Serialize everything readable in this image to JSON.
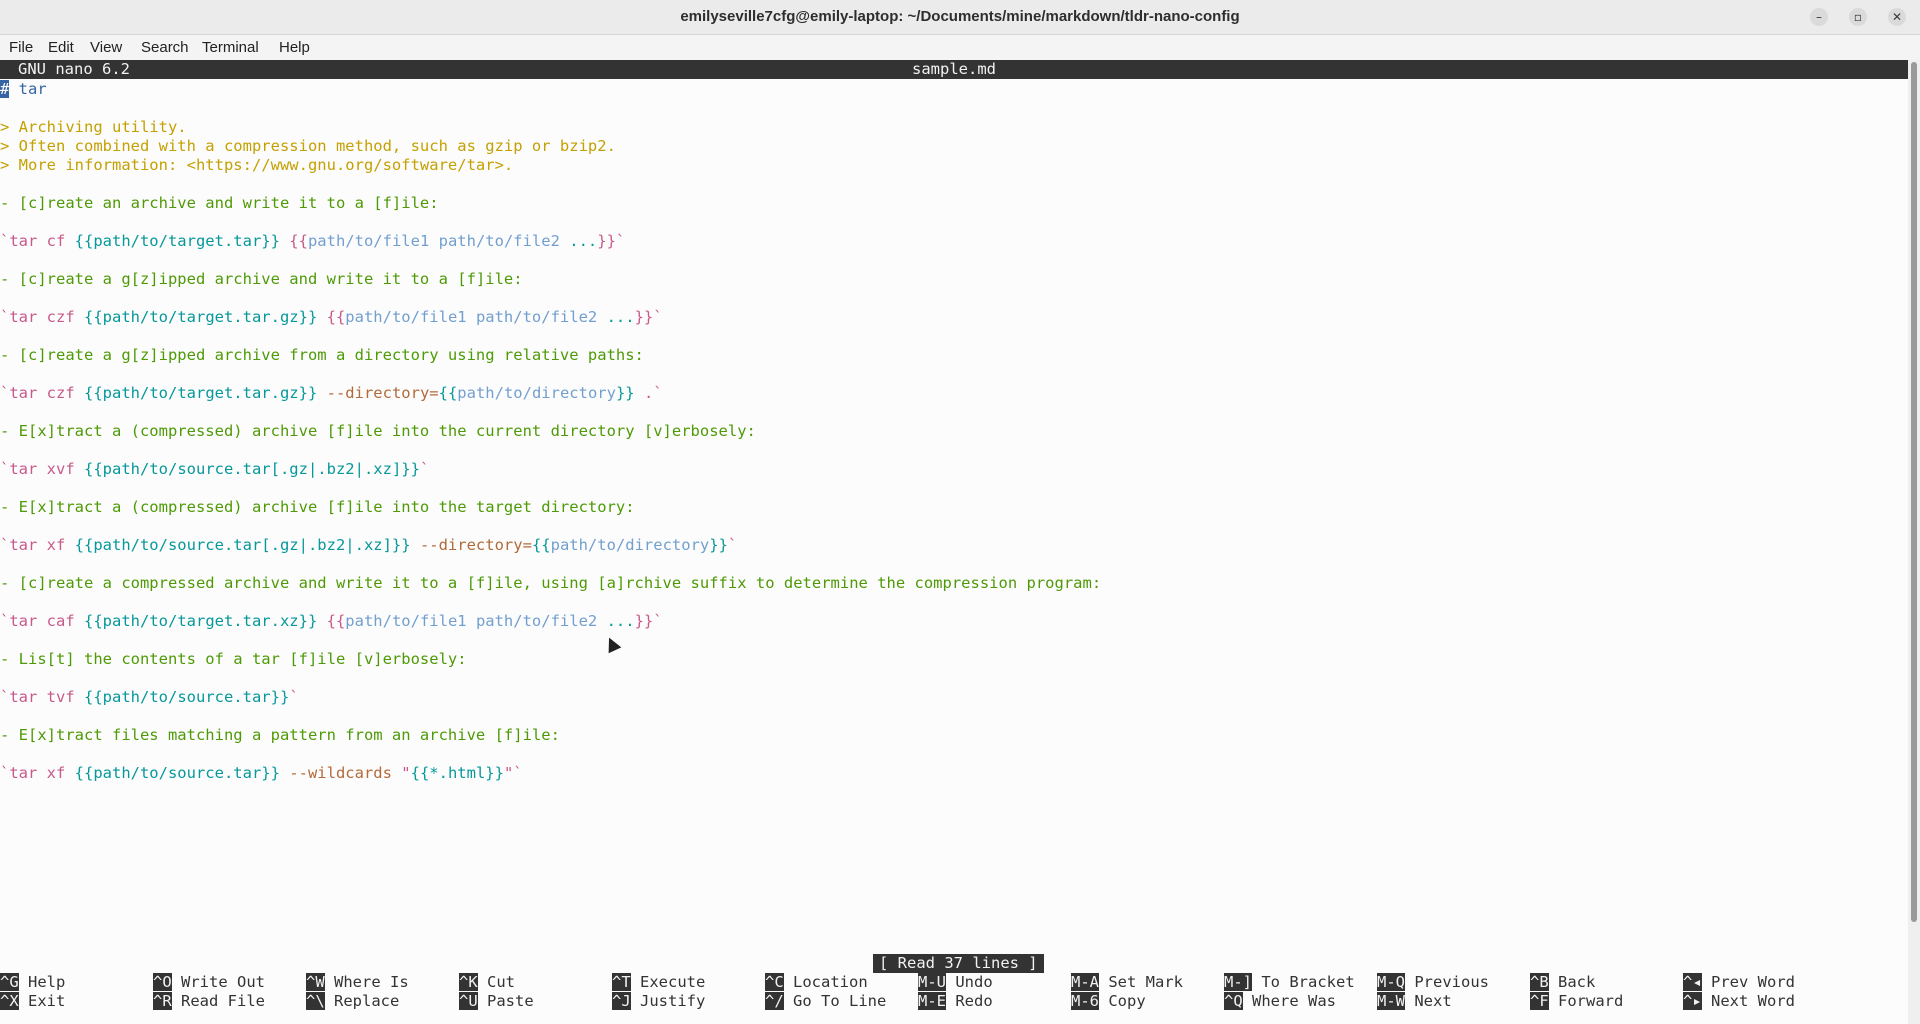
{
  "window": {
    "title": "emilyseville7cfg@emily-laptop: ~/Documents/mine/markdown/tldr-nano-config",
    "buttons": {
      "minimize": "–",
      "maximize": "▫",
      "close": "✕"
    }
  },
  "menu": [
    "File",
    "Edit",
    "View",
    "Search",
    "Terminal",
    "Help"
  ],
  "editor": {
    "version": "GNU nano 6.2",
    "filename": "sample.md",
    "status": "[ Read 37 lines ]"
  },
  "lines": [
    {
      "segs": [
        {
          "t": "#",
          "c": "cursor"
        },
        {
          "t": " tar",
          "c": "c-head"
        }
      ]
    },
    {
      "segs": []
    },
    {
      "segs": [
        {
          "t": "> Archiving utility.",
          "c": "c-quote"
        }
      ]
    },
    {
      "segs": [
        {
          "t": "> Often combined with a compression method, such as gzip or bzip2.",
          "c": "c-quote"
        }
      ]
    },
    {
      "segs": [
        {
          "t": "> More information: <https://www.gnu.org/software/tar>.",
          "c": "c-quote"
        }
      ]
    },
    {
      "segs": []
    },
    {
      "segs": [
        {
          "t": "- [c]reate an archive and write it to a [f]ile:",
          "c": "c-desc"
        }
      ]
    },
    {
      "segs": []
    },
    {
      "segs": [
        {
          "t": "`tar cf ",
          "c": "c-cmd"
        },
        {
          "t": "{{path/to/target.tar}}",
          "c": "c-tok"
        },
        {
          "t": " {{",
          "c": "c-cmd"
        },
        {
          "t": "path/to/file1 path/to/file2 ",
          "c": "c-var"
        },
        {
          "t": "...",
          "c": "c-tok"
        },
        {
          "t": "}}`",
          "c": "c-cmd"
        }
      ]
    },
    {
      "segs": []
    },
    {
      "segs": [
        {
          "t": "- [c]reate a g[z]ipped archive and write it to a [f]ile:",
          "c": "c-desc"
        }
      ]
    },
    {
      "segs": []
    },
    {
      "segs": [
        {
          "t": "`tar czf ",
          "c": "c-cmd"
        },
        {
          "t": "{{path/to/target.tar.gz}}",
          "c": "c-tok"
        },
        {
          "t": " {{",
          "c": "c-cmd"
        },
        {
          "t": "path/to/file1 path/to/file2 ",
          "c": "c-var"
        },
        {
          "t": "...",
          "c": "c-tok"
        },
        {
          "t": "}}`",
          "c": "c-cmd"
        }
      ]
    },
    {
      "segs": []
    },
    {
      "segs": [
        {
          "t": "- [c]reate a g[z]ipped archive from a directory using relative paths:",
          "c": "c-desc"
        }
      ]
    },
    {
      "segs": []
    },
    {
      "segs": [
        {
          "t": "`tar czf ",
          "c": "c-cmd"
        },
        {
          "t": "{{path/to/target.tar.gz}}",
          "c": "c-tok"
        },
        {
          "t": " --directory=",
          "c": "c-opt"
        },
        {
          "t": "{{",
          "c": "c-tok"
        },
        {
          "t": "path/to/directory",
          "c": "c-var"
        },
        {
          "t": "}}",
          "c": "c-tok"
        },
        {
          "t": " .`",
          "c": "c-cmd"
        }
      ]
    },
    {
      "segs": []
    },
    {
      "segs": [
        {
          "t": "- E[x]tract a (compressed) archive [f]ile into the current directory [v]erbosely:",
          "c": "c-desc"
        }
      ]
    },
    {
      "segs": []
    },
    {
      "segs": [
        {
          "t": "`tar xvf ",
          "c": "c-cmd"
        },
        {
          "t": "{{path/to/source.tar[.gz|.bz2|.xz]}}",
          "c": "c-tok"
        },
        {
          "t": "`",
          "c": "c-cmd"
        }
      ]
    },
    {
      "segs": []
    },
    {
      "segs": [
        {
          "t": "- E[x]tract a (compressed) archive [f]ile into the target directory:",
          "c": "c-desc"
        }
      ]
    },
    {
      "segs": []
    },
    {
      "segs": [
        {
          "t": "`tar xf ",
          "c": "c-cmd"
        },
        {
          "t": "{{path/to/source.tar[.gz|.bz2|.xz]}}",
          "c": "c-tok"
        },
        {
          "t": " --directory=",
          "c": "c-opt"
        },
        {
          "t": "{{",
          "c": "c-tok"
        },
        {
          "t": "path/to/directory",
          "c": "c-var"
        },
        {
          "t": "}}",
          "c": "c-tok"
        },
        {
          "t": "`",
          "c": "c-cmd"
        }
      ]
    },
    {
      "segs": []
    },
    {
      "segs": [
        {
          "t": "- [c]reate a compressed archive and write it to a [f]ile, using [a]rchive suffix to determine the compression program:",
          "c": "c-desc"
        }
      ]
    },
    {
      "segs": []
    },
    {
      "segs": [
        {
          "t": "`tar caf ",
          "c": "c-cmd"
        },
        {
          "t": "{{path/to/target.tar.xz}}",
          "c": "c-tok"
        },
        {
          "t": " {{",
          "c": "c-cmd"
        },
        {
          "t": "path/to/file1 path/to/file2 ",
          "c": "c-var"
        },
        {
          "t": "...",
          "c": "c-tok"
        },
        {
          "t": "}}`",
          "c": "c-cmd"
        }
      ]
    },
    {
      "segs": []
    },
    {
      "segs": [
        {
          "t": "- Lis[t] the contents of a tar [f]ile [v]erbosely:",
          "c": "c-desc"
        }
      ]
    },
    {
      "segs": []
    },
    {
      "segs": [
        {
          "t": "`tar tvf ",
          "c": "c-cmd"
        },
        {
          "t": "{{path/to/source.tar}}",
          "c": "c-tok"
        },
        {
          "t": "`",
          "c": "c-cmd"
        }
      ]
    },
    {
      "segs": []
    },
    {
      "segs": [
        {
          "t": "- E[x]tract files matching a pattern from an archive [f]ile:",
          "c": "c-desc"
        }
      ]
    },
    {
      "segs": []
    },
    {
      "segs": [
        {
          "t": "`tar xf ",
          "c": "c-cmd"
        },
        {
          "t": "{{path/to/source.tar}}",
          "c": "c-tok"
        },
        {
          "t": " --wildcards ",
          "c": "c-opt"
        },
        {
          "t": "\"",
          "c": "c-cmd"
        },
        {
          "t": "{{*.html}}",
          "c": "c-tok"
        },
        {
          "t": "\"`",
          "c": "c-cmd"
        }
      ]
    }
  ],
  "shortcuts": [
    [
      {
        "key": "^G",
        "label": "Help"
      },
      {
        "key": "^O",
        "label": "Write Out"
      },
      {
        "key": "^W",
        "label": "Where Is"
      },
      {
        "key": "^K",
        "label": "Cut"
      },
      {
        "key": "^T",
        "label": "Execute"
      },
      {
        "key": "^C",
        "label": "Location"
      },
      {
        "key": "M-U",
        "label": "Undo"
      },
      {
        "key": "M-A",
        "label": "Set Mark"
      },
      {
        "key": "M-]",
        "label": "To Bracket"
      },
      {
        "key": "M-Q",
        "label": "Previous"
      },
      {
        "key": "^B",
        "label": "Back"
      },
      {
        "key": "^◂",
        "label": "Prev Word"
      }
    ],
    [
      {
        "key": "^X",
        "label": "Exit"
      },
      {
        "key": "^R",
        "label": "Read File"
      },
      {
        "key": "^\\",
        "label": "Replace"
      },
      {
        "key": "^U",
        "label": "Paste"
      },
      {
        "key": "^J",
        "label": "Justify"
      },
      {
        "key": "^/",
        "label": "Go To Line"
      },
      {
        "key": "M-E",
        "label": "Redo"
      },
      {
        "key": "M-6",
        "label": "Copy"
      },
      {
        "key": "^Q",
        "label": "Where Was"
      },
      {
        "key": "M-W",
        "label": "Next"
      },
      {
        "key": "^F",
        "label": "Forward"
      },
      {
        "key": "^▸",
        "label": "Next Word"
      }
    ]
  ]
}
